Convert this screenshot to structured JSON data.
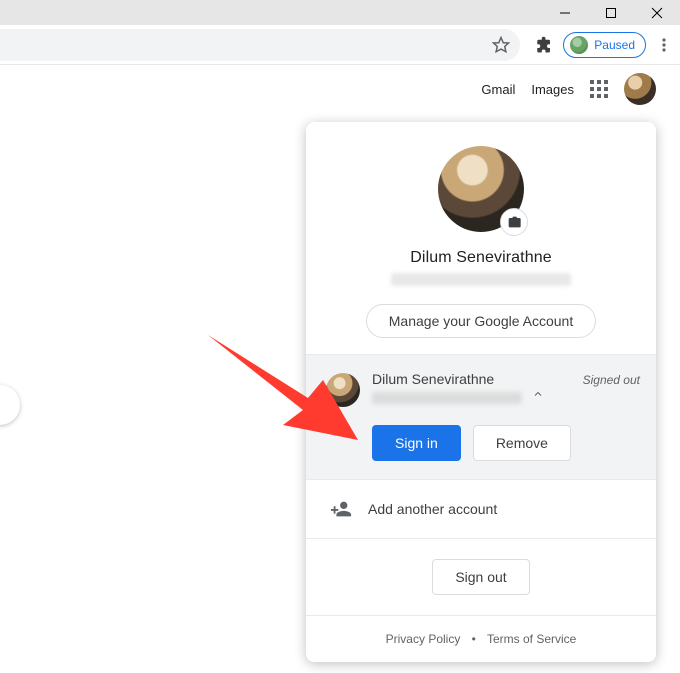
{
  "window": {
    "controls": {
      "minimize": "minimize",
      "maximize": "maximize",
      "close": "close"
    }
  },
  "toolbar": {
    "paused_label": "Paused"
  },
  "header": {
    "gmail": "Gmail",
    "images": "Images"
  },
  "account_card": {
    "name": "Dilum Senevirathne",
    "manage_label": "Manage your Google Account",
    "other_account": {
      "name": "Dilum Senevirathne",
      "status": "Signed out",
      "sign_in_label": "Sign in",
      "remove_label": "Remove"
    },
    "add_label": "Add another account",
    "sign_out_label": "Sign out",
    "privacy_label": "Privacy Policy",
    "terms_label": "Terms of Service"
  }
}
